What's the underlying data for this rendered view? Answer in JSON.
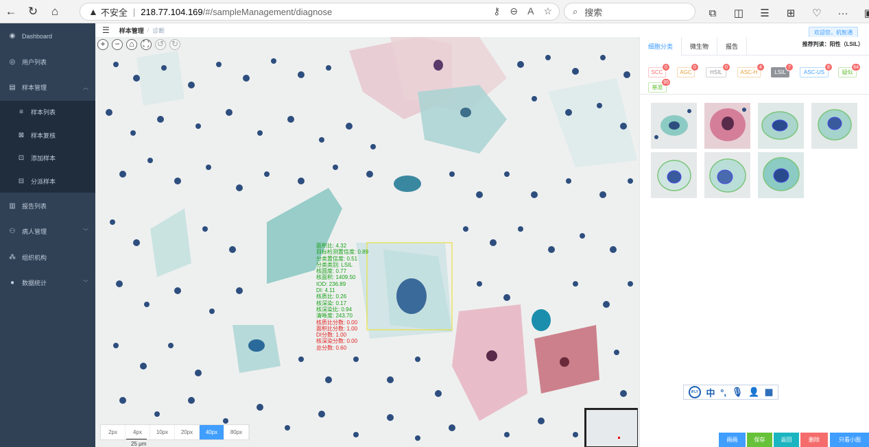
{
  "browser": {
    "insecure_label": "不安全",
    "url_host": "218.77.104.169",
    "url_path": "/#/sampleManagement/diagnose",
    "search_placeholder": "搜索"
  },
  "sidebar": {
    "items": [
      {
        "label": "Dashboard",
        "icon": "dashboard-icon"
      },
      {
        "label": "用户列表",
        "icon": "user-icon"
      },
      {
        "label": "样本管理",
        "icon": "sample-icon"
      },
      {
        "label": "样本列表",
        "icon": "list-icon"
      },
      {
        "label": "样本复核",
        "icon": "review-icon"
      },
      {
        "label": "添加样本",
        "icon": "add-icon"
      },
      {
        "label": "分派样本",
        "icon": "assign-icon"
      },
      {
        "label": "报告列表",
        "icon": "report-icon"
      },
      {
        "label": "病人管理",
        "icon": "patient-icon"
      },
      {
        "label": "组织机构",
        "icon": "org-icon"
      },
      {
        "label": "数据统计",
        "icon": "stats-icon"
      }
    ]
  },
  "header": {
    "breadcrumb_1": "样本管理",
    "breadcrumb_sep": "/",
    "breadcrumb_2": "诊断",
    "welcome": "欢迎您，机智通"
  },
  "viewer": {
    "scale_options": [
      "2px",
      "4px",
      "10px",
      "20px",
      "40px",
      "80px"
    ],
    "scale_active": "40px",
    "scale_label": "25 μm",
    "metrics": [
      {
        "text": "面积比: 4.32",
        "color": "g"
      },
      {
        "text": "目标检测置信度: 0.89",
        "color": "g"
      },
      {
        "text": "分类置信度: 0.51",
        "color": "g"
      },
      {
        "text": "分类类别: LSIL",
        "color": "g"
      },
      {
        "text": "核圆度: 0.77",
        "color": "g"
      },
      {
        "text": "核面积: 1409.50",
        "color": "g"
      },
      {
        "text": "IOD: 236.89",
        "color": "g"
      },
      {
        "text": "DI: 4.11",
        "color": "g"
      },
      {
        "text": "核质比: 0.26",
        "color": "g"
      },
      {
        "text": "核深染: 0.17",
        "color": "g"
      },
      {
        "text": "核深染比: 0.94",
        "color": "g"
      },
      {
        "text": "清晰度: 243.70",
        "color": "g"
      },
      {
        "text": "核质比分数: 0.00",
        "color": "r"
      },
      {
        "text": "面积比分数: 1.00",
        "color": "r"
      },
      {
        "text": "DI分数: 1.00",
        "color": "r"
      },
      {
        "text": "核深染分数: 0.00",
        "color": "r"
      },
      {
        "text": "总分数: 0.60",
        "color": "r"
      }
    ]
  },
  "panel": {
    "tabs": [
      "细胞分类",
      "微生物",
      "报告"
    ],
    "active_tab": "细胞分类",
    "recommend": "推荐判读：阳性（LSIL）",
    "categories": [
      {
        "label": "SCC",
        "count": "0"
      },
      {
        "label": "AGC",
        "count": "0"
      },
      {
        "label": "HSIL",
        "count": "0"
      },
      {
        "label": "ASC-H",
        "count": "4"
      },
      {
        "label": "LSIL",
        "count": "7"
      },
      {
        "label": "ASC-US",
        "count": "8"
      },
      {
        "label": "疑似",
        "count": "64"
      },
      {
        "label": "基准",
        "count": "95"
      }
    ]
  },
  "toolbar_icons": [
    "ifly-logo-icon",
    "chinese-input-icon",
    "punctuation-icon",
    "mic-icon",
    "user-icon",
    "grid-icon"
  ],
  "toolbar": {
    "ifly": "iFLY",
    "zh": "中"
  },
  "actions": {
    "draw": "画画",
    "save": "保存",
    "back": "返回",
    "delete": "删除",
    "small_only": "只看小图"
  }
}
